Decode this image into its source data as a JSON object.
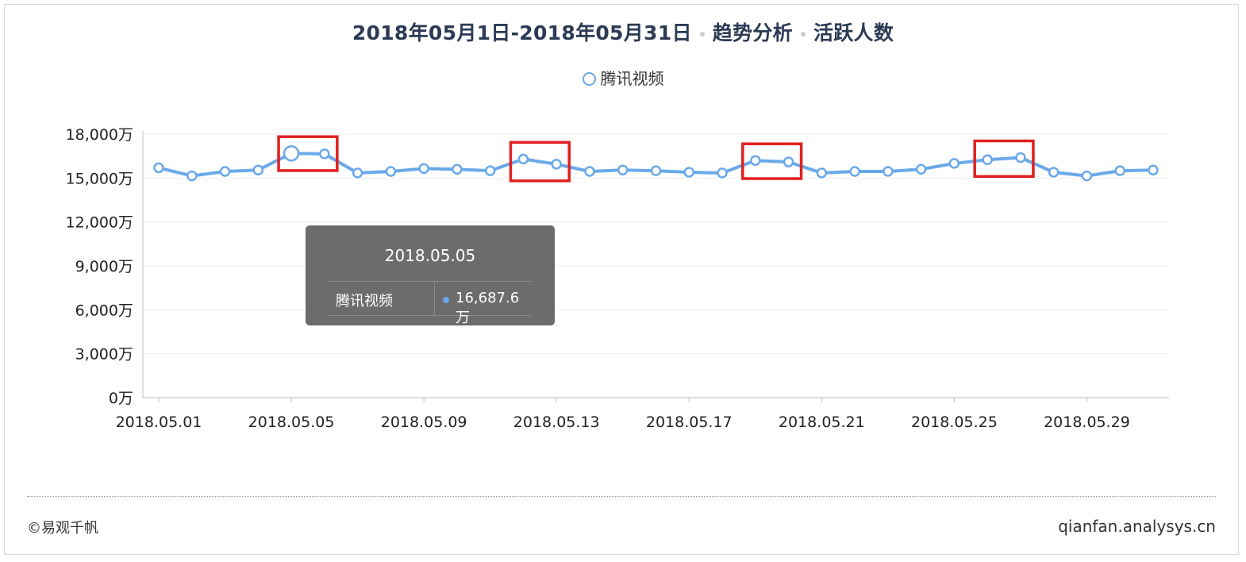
{
  "title": {
    "part1": "2018年05月1日-2018年05月31日",
    "part2": "趋势分析",
    "part3": "活跃人数"
  },
  "legend": {
    "series_name": "腾讯视频"
  },
  "chart_data": {
    "type": "line",
    "y_unit": "万",
    "ylim": [
      0,
      18000
    ],
    "yticks": [
      0,
      3000,
      6000,
      9000,
      12000,
      15000,
      18000
    ],
    "ytick_labels": [
      "0万",
      "3,000万",
      "6,000万",
      "9,000万",
      "12,000万",
      "15,000万",
      "18,000万"
    ],
    "xtick_labels": [
      "2018.05.01",
      "2018.05.05",
      "2018.05.09",
      "2018.05.13",
      "2018.05.17",
      "2018.05.21",
      "2018.05.25",
      "2018.05.29"
    ],
    "grid": "horizontal",
    "legend_position": "top-center",
    "color": "#6aa9e9",
    "x": [
      "2018.05.01",
      "2018.05.02",
      "2018.05.03",
      "2018.05.04",
      "2018.05.05",
      "2018.05.06",
      "2018.05.07",
      "2018.05.08",
      "2018.05.09",
      "2018.05.10",
      "2018.05.11",
      "2018.05.12",
      "2018.05.13",
      "2018.05.14",
      "2018.05.15",
      "2018.05.16",
      "2018.05.17",
      "2018.05.18",
      "2018.05.19",
      "2018.05.20",
      "2018.05.21",
      "2018.05.22",
      "2018.05.23",
      "2018.05.24",
      "2018.05.25",
      "2018.05.26",
      "2018.05.27",
      "2018.05.28",
      "2018.05.29",
      "2018.05.30",
      "2018.05.31"
    ],
    "series": [
      {
        "name": "腾讯视频",
        "values": [
          15700,
          15150,
          15450,
          15550,
          16687.6,
          16650,
          15350,
          15450,
          15650,
          15600,
          15500,
          16300,
          15950,
          15450,
          15550,
          15500,
          15400,
          15350,
          16200,
          16100,
          15350,
          15450,
          15450,
          15600,
          16000,
          16250,
          16400,
          15400,
          15150,
          15500,
          15550
        ]
      }
    ],
    "highlighted_dates": [
      [
        "2018.05.05",
        "2018.05.06"
      ],
      [
        "2018.05.12",
        "2018.05.13"
      ],
      [
        "2018.05.19",
        "2018.05.20"
      ],
      [
        "2018.05.26",
        "2018.05.27"
      ]
    ]
  },
  "tooltip": {
    "date": "2018.05.05",
    "series_name": "腾讯视频",
    "value": "16,687.6万"
  },
  "footer": {
    "copyright": "©易观千帆",
    "site": "qianfan.analysys.cn"
  }
}
